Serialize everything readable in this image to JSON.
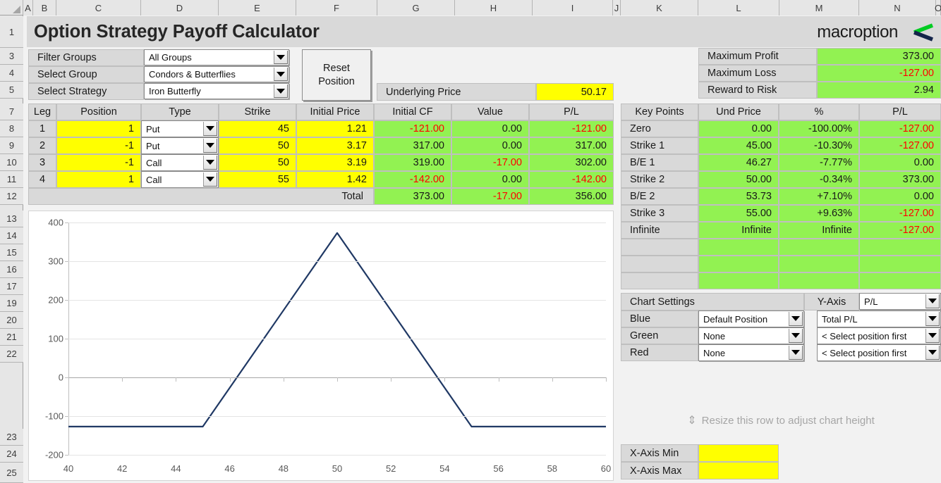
{
  "app": {
    "title": "Option Strategy Payoff Calculator",
    "brand": "macroption"
  },
  "grid": {
    "columns": [
      "A",
      "B",
      "C",
      "D",
      "E",
      "F",
      "G",
      "H",
      "I",
      "J",
      "K",
      "L",
      "M",
      "N",
      "O"
    ],
    "rows": [
      "1",
      "3",
      "4",
      "5",
      "7",
      "8",
      "9",
      "10",
      "11",
      "12",
      "13",
      "14",
      "15",
      "16",
      "17",
      "19",
      "20",
      "21",
      "22",
      "23",
      "24",
      "25"
    ]
  },
  "selectors": {
    "filter_groups_label": "Filter Groups",
    "filter_groups_value": "All Groups",
    "select_group_label": "Select Group",
    "select_group_value": "Condors & Butterflies",
    "select_strategy_label": "Select Strategy",
    "select_strategy_value": "Iron Butterfly",
    "reset_button": "Reset\nPosition",
    "reset_button_line1": "Reset",
    "reset_button_line2": "Position"
  },
  "underlying": {
    "label": "Underlying Price",
    "value": "50.17"
  },
  "summary": {
    "rows": [
      {
        "label": "Maximum Profit",
        "value": "373.00",
        "negative": false
      },
      {
        "label": "Maximum Loss",
        "value": "-127.00",
        "negative": true
      },
      {
        "label": "Reward to Risk",
        "value": "2.94",
        "negative": false
      }
    ]
  },
  "legs": {
    "headers": [
      "Leg",
      "Position",
      "Type",
      "Strike",
      "Initial Price",
      "Initial CF",
      "Value",
      "P/L"
    ],
    "rows": [
      {
        "leg": "1",
        "position": "1",
        "type": "Put",
        "strike": "45",
        "initial_price": "1.21",
        "initial_cf": "-121.00",
        "cf_neg": true,
        "value": "0.00",
        "value_neg": false,
        "pl": "-121.00",
        "pl_neg": true
      },
      {
        "leg": "2",
        "position": "-1",
        "type": "Put",
        "strike": "50",
        "initial_price": "3.17",
        "initial_cf": "317.00",
        "cf_neg": false,
        "value": "0.00",
        "value_neg": false,
        "pl": "317.00",
        "pl_neg": false
      },
      {
        "leg": "3",
        "position": "-1",
        "type": "Call",
        "strike": "50",
        "initial_price": "3.19",
        "initial_cf": "319.00",
        "cf_neg": false,
        "value": "-17.00",
        "value_neg": true,
        "pl": "302.00",
        "pl_neg": false
      },
      {
        "leg": "4",
        "position": "1",
        "type": "Call",
        "strike": "55",
        "initial_price": "1.42",
        "initial_cf": "-142.00",
        "cf_neg": true,
        "value": "0.00",
        "value_neg": false,
        "pl": "-142.00",
        "pl_neg": true
      }
    ],
    "total_label": "Total",
    "total_initial_cf": "373.00",
    "total_value": "-17.00",
    "total_pl": "356.00"
  },
  "key_points": {
    "headers": [
      "Key Points",
      "Und Price",
      "%",
      "P/L"
    ],
    "rows": [
      {
        "name": "Zero",
        "und_price": "0.00",
        "pct": "-100.00%",
        "pl": "-127.00",
        "pl_neg": true
      },
      {
        "name": "Strike 1",
        "und_price": "45.00",
        "pct": "-10.30%",
        "pl": "-127.00",
        "pl_neg": true
      },
      {
        "name": "B/E 1",
        "und_price": "46.27",
        "pct": "-7.77%",
        "pl": "0.00",
        "pl_neg": false
      },
      {
        "name": "Strike 2",
        "und_price": "50.00",
        "pct": "-0.34%",
        "pl": "373.00",
        "pl_neg": false
      },
      {
        "name": "B/E 2",
        "und_price": "53.73",
        "pct": "+7.10%",
        "pl": "0.00",
        "pl_neg": false
      },
      {
        "name": "Strike 3",
        "und_price": "55.00",
        "pct": "+9.63%",
        "pl": "-127.00",
        "pl_neg": true
      },
      {
        "name": "Infinite",
        "und_price": "Infinite",
        "pct": "Infinite",
        "pl": "-127.00",
        "pl_neg": true
      },
      {
        "name": "",
        "und_price": "",
        "pct": "",
        "pl": "",
        "pl_neg": false
      },
      {
        "name": "",
        "und_price": "",
        "pct": "",
        "pl": "",
        "pl_neg": false
      },
      {
        "name": "",
        "und_price": "",
        "pct": "",
        "pl": "",
        "pl_neg": false
      }
    ]
  },
  "chart_settings": {
    "title": "Chart Settings",
    "yaxis_label": "Y-Axis",
    "yaxis_value": "P/L",
    "series": [
      {
        "color_label": "Blue",
        "position": "Default Position",
        "metric": "Total P/L"
      },
      {
        "color_label": "Green",
        "position": "None",
        "metric": "< Select position first"
      },
      {
        "color_label": "Red",
        "position": "None",
        "metric": "< Select position first"
      }
    ],
    "resize_hint": "Resize this row to adjust chart height",
    "resize_hint_arrow": "⇕",
    "x_axis_min_label": "X-Axis Min",
    "x_axis_min_value": "",
    "x_axis_max_label": "X-Axis Max",
    "x_axis_max_value": ""
  },
  "colors": {
    "yellow_input": "#ffff00",
    "green_output": "#92f252",
    "grey_label": "#d9d9d9",
    "negative_text": "#ff0000",
    "series_blue": "#1f3864",
    "brand_green": "#00cc22",
    "brand_navy": "#14244a"
  },
  "chart_data": {
    "type": "line",
    "title": "",
    "xlabel": "",
    "ylabel": "",
    "xlim": [
      40,
      60
    ],
    "ylim": [
      -200,
      400
    ],
    "xticks": [
      40,
      42,
      44,
      46,
      48,
      50,
      52,
      54,
      56,
      58,
      60
    ],
    "yticks": [
      -200,
      -100,
      0,
      100,
      200,
      300,
      400
    ],
    "grid": true,
    "legend": null,
    "series": [
      {
        "name": "Total P/L",
        "color": "#1f3864",
        "x": [
          40,
          45,
          46.27,
          50,
          53.73,
          55,
          60
        ],
        "y": [
          -127,
          -127,
          0,
          373,
          0,
          -127,
          -127
        ]
      }
    ]
  }
}
